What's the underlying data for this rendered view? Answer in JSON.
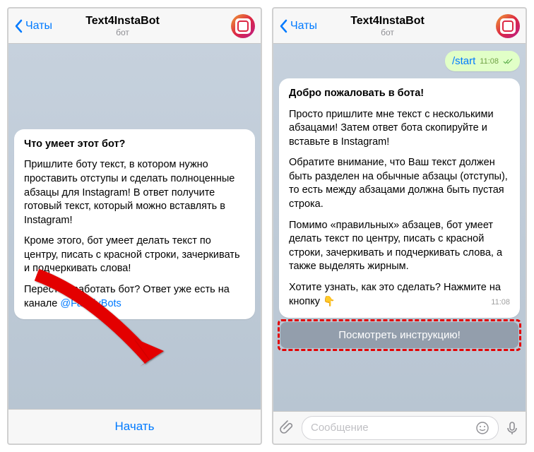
{
  "header": {
    "back": "Чаты",
    "title": "Text4InstaBot",
    "subtitle": "бот"
  },
  "phone1": {
    "msg": {
      "heading": "Что умеет этот бот?",
      "p1": "Пришлите боту текст, в котором нужно проставить отступы и сделать полноценные абзацы для Instagram! В ответ получите готовый текст, который можно вставлять в Instagram!",
      "p2": "Кроме этого, бот умеет делать текст по центру, писать с красной строки, зачеркивать и подчеркивать слова!",
      "p3_pre": "Перестал работать бот? Ответ уже есть на канале ",
      "p3_link": "@FamilyBots"
    },
    "start": "Начать"
  },
  "phone2": {
    "out": {
      "cmd": "/start",
      "time": "11:08"
    },
    "msg": {
      "heading": "Добро пожаловать в бота!",
      "p1": "Просто пришлите мне текст с несколькими абзацами! Затем ответ бота скопируйте и вставьте в Instagram!",
      "p2": "Обратите внимание, что Ваш текст должен быть разделен на обычные абзацы (отступы), то есть между абзацами должна быть пустая строка.",
      "p3": "Помимо «правильных» абзацев, бот умеет делать текст по центру, писать с красной строки, зачеркивать и подчеркивать слова, а также выделять жирным.",
      "p4": "Хотите узнать, как это сделать? Нажмите на кнопку ",
      "emoji": "👇",
      "time": "11:08"
    },
    "inline_button": "Посмотреть инструкцию!",
    "input_placeholder": "Сообщение"
  }
}
